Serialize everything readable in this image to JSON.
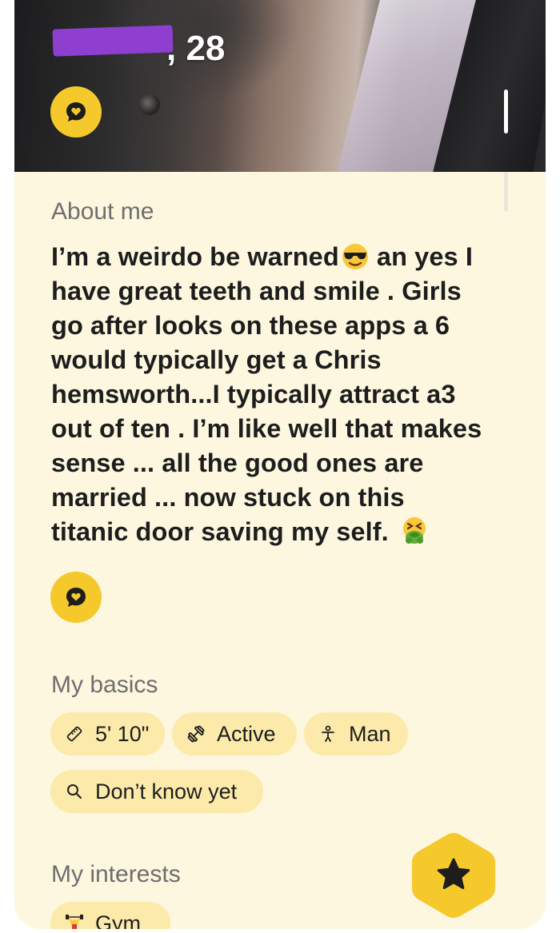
{
  "profile": {
    "age_text": ", 28"
  },
  "about": {
    "title": "About me",
    "bio_lines": [
      "I’m a weirdo be warned",
      " an yes I",
      "have great teeth and smile . Girls",
      "go after looks on these apps a 6",
      "would typically get a Chris",
      "hemsworth...I typically attract a3",
      "out of ten . I’m like well that makes",
      "sense ... all the good ones are",
      "married ... now stuck on this",
      "titanic door saving my self. "
    ]
  },
  "basics": {
    "title": "My basics",
    "chips": [
      {
        "icon": "ruler-icon",
        "label": "5' 10\""
      },
      {
        "icon": "dumbbell-icon",
        "label": "Active"
      },
      {
        "icon": "person-icon",
        "label": "Man"
      },
      {
        "icon": "search-icon",
        "label": "Don’t know yet"
      }
    ]
  },
  "interests": {
    "title": "My interests",
    "chips": [
      {
        "icon": "weightlifter-icon",
        "label": "Gym"
      }
    ]
  },
  "colors": {
    "card_bg": "#fdf7df",
    "chip_bg": "#fbeaa9",
    "accent": "#f5c92c",
    "name_redaction": "#8e3fd0"
  }
}
